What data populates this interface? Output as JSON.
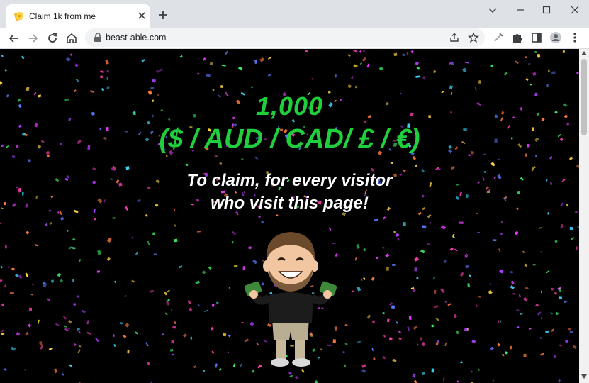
{
  "browser": {
    "tab": {
      "title": "Claim 1k from me",
      "favicon": "money-favicon-icon"
    },
    "url": "beast-able.com",
    "icons": [
      "back-icon",
      "forward-icon",
      "reload-icon",
      "home-icon",
      "lock-icon",
      "share-icon",
      "star-icon",
      "extension-icon",
      "puzzle-icon",
      "sidebar-icon",
      "profile-icon",
      "menu-icon",
      "minimize-icon",
      "maximize-icon",
      "close-icon",
      "new-tab-icon"
    ]
  },
  "page": {
    "amount": "1,000",
    "currencies": "($ / AUD / CAD/ £ / €)",
    "claim_line1": "To claim, for every visitor",
    "claim_line2": "who visit this page!",
    "accent_color": "#1fcf3c",
    "background_color": "#000000",
    "mascot": "cartoon-character-holding-money"
  }
}
